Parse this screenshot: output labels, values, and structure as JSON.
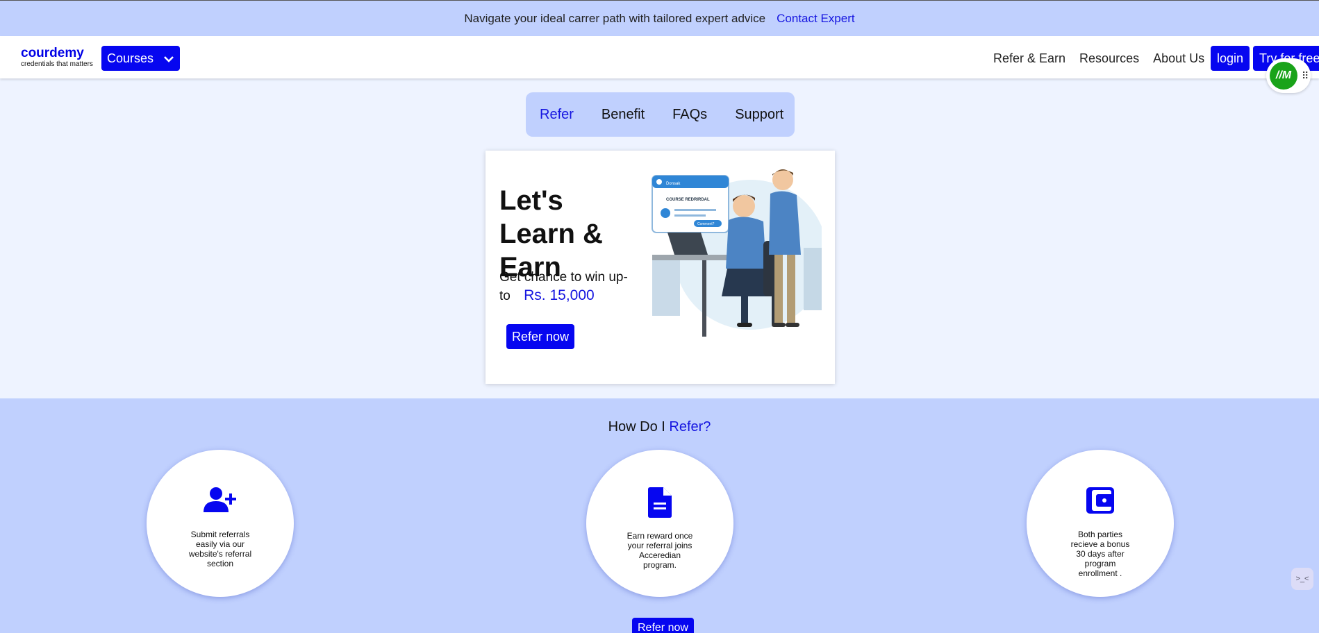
{
  "announcement": {
    "text": "Navigate your ideal carrer path with tailored expert advice",
    "link": "Contact Expert"
  },
  "header": {
    "logo_name": "courdemy",
    "logo_tagline": "credentials that matters",
    "courses_label": "Courses",
    "nav": [
      "Refer & Earn",
      "Resources",
      "About Us"
    ],
    "login_label": "login",
    "try_label": "Try for free"
  },
  "extension_badge": "//M",
  "tabs": [
    "Refer",
    "Benefit",
    "FAQs",
    "Support"
  ],
  "hero": {
    "title": "Let's Learn & Earn",
    "subtitle": "Get chance to win up-to",
    "amount": "Rs. 15,000",
    "button": "Refer now",
    "illustration_text": {
      "app": "Donsak",
      "card": "COURSE REDRIRDAL",
      "pill": "Comment?"
    }
  },
  "how": {
    "title_prefix": "How Do I",
    "title_highlight": "Refer?",
    "steps": [
      {
        "icon": "user-plus-icon",
        "text": "Submit referrals easily via our website's referral section"
      },
      {
        "icon": "document-icon",
        "text": "Earn reward once your referral joins Acceredian program."
      },
      {
        "icon": "wallet-icon",
        "text": "Both parties recieve a bonus 30 days after program enrollment ."
      }
    ],
    "button": "Refer now"
  },
  "colors": {
    "accent": "#0606f0",
    "light_blue": "#c0d0fe",
    "page_bg": "#eef3ff"
  }
}
